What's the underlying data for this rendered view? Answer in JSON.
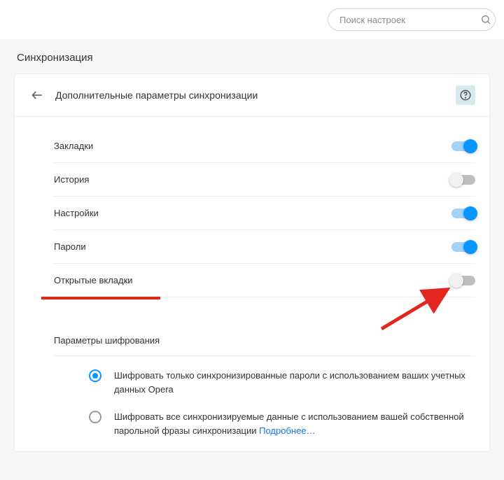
{
  "search": {
    "placeholder": "Поиск настроек"
  },
  "page": {
    "title": "Синхронизация",
    "card_title": "Дополнительные параметры синхронизации"
  },
  "toggles": [
    {
      "label": "Закладки",
      "on": true,
      "underline": false
    },
    {
      "label": "История",
      "on": false,
      "underline": false
    },
    {
      "label": "Настройки",
      "on": true,
      "underline": false
    },
    {
      "label": "Пароли",
      "on": true,
      "underline": false
    },
    {
      "label": "Открытые вкладки",
      "on": false,
      "underline": true
    }
  ],
  "encryption": {
    "section_label": "Параметры шифрования",
    "options": [
      {
        "text": "Шифровать только синхронизированные пароли с использованием ваших учетных данных Opera",
        "checked": true,
        "link": null
      },
      {
        "text": "Шифровать все синхронизируемые данные с использованием вашей собственной парольной фразы синхронизации",
        "checked": false,
        "link": "Подробнее…"
      }
    ]
  },
  "annotations": {
    "arrow_color": "#e52620"
  }
}
